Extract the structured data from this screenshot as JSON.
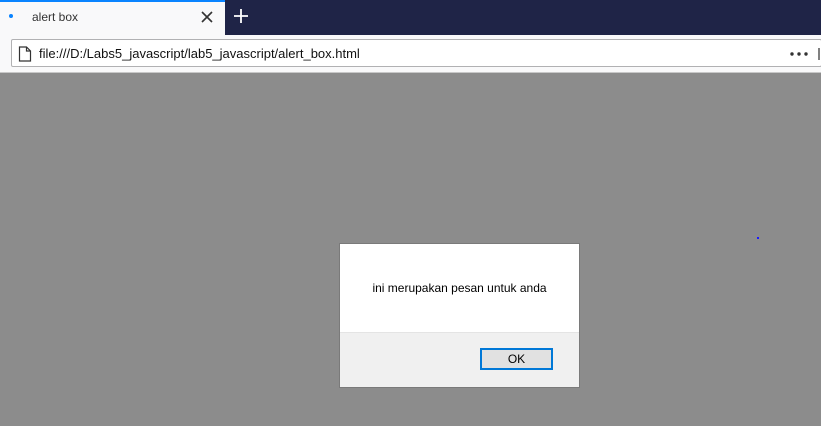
{
  "browser": {
    "tab": {
      "title": "alert box",
      "close_icon": "close-icon",
      "loading_icon": "tab-dot-icon"
    },
    "new_tab_icon": "plus-icon",
    "address_bar": {
      "url": "file:///D:/Labs5_javascript/lab5_javascript/alert_box.html",
      "page_icon": "page-icon",
      "menu_icon": "more-icon"
    },
    "colors": {
      "tabstrip": "#1f2447",
      "accent": "#0a84ff",
      "content_background": "#8c8c8c"
    }
  },
  "alert_dialog": {
    "message": "ini merupakan pesan untuk anda",
    "ok_label": "OK",
    "button_border_color": "#0078d7"
  }
}
